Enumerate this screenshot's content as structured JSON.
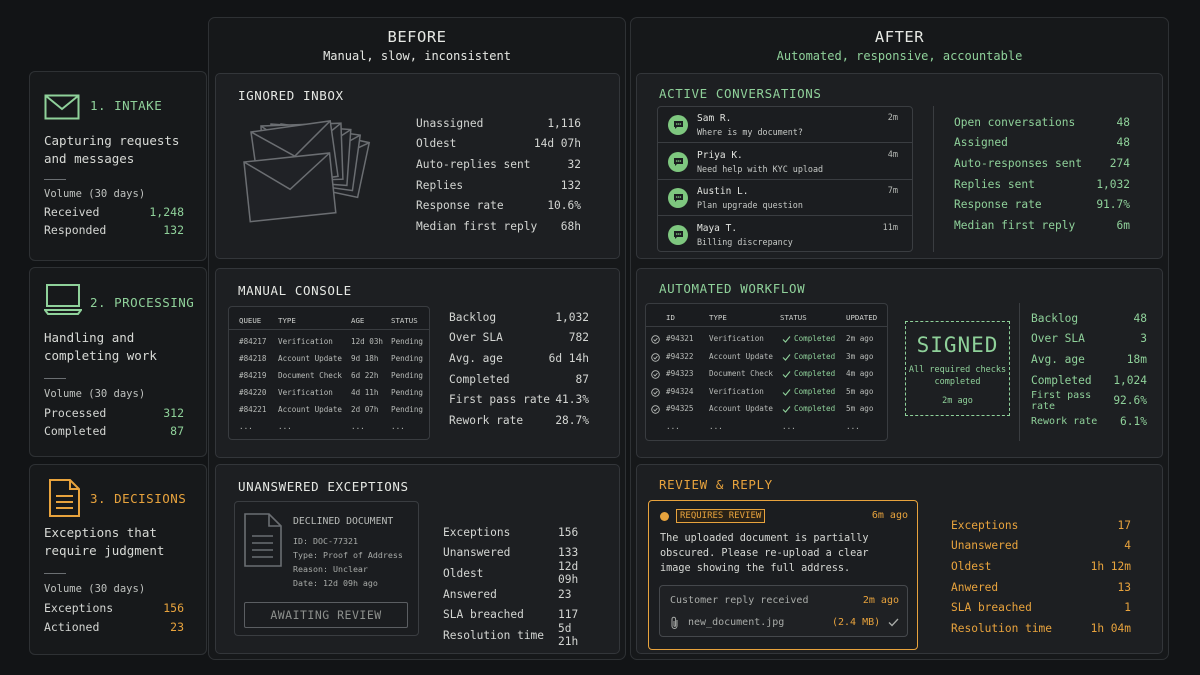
{
  "stages": [
    {
      "title": "1. INTAKE",
      "icon": "envelope-icon",
      "desc": "Capturing requests and messages",
      "volume_label": "Volume (30 days)",
      "rows": [
        {
          "label": "Received",
          "value": "1,248"
        },
        {
          "label": "Responded",
          "value": "132"
        }
      ]
    },
    {
      "title": "2. PROCESSING",
      "icon": "laptop-icon",
      "desc": "Handling and completing work",
      "volume_label": "Volume (30 days)",
      "rows": [
        {
          "label": "Processed",
          "value": "312"
        },
        {
          "label": "Completed",
          "value": "87"
        }
      ]
    },
    {
      "title": "3. DECISIONS",
      "icon": "document-icon",
      "desc": "Exceptions that require judgment",
      "volume_label": "Volume (30 days)",
      "rows": [
        {
          "label": "Exceptions",
          "value": "156"
        },
        {
          "label": "Actioned",
          "value": "23"
        }
      ]
    }
  ],
  "before": {
    "title": "BEFORE",
    "subtitle": "Manual, slow, inconsistent",
    "inbox": {
      "title": "IGNORED INBOX",
      "stats": [
        {
          "label": "Unassigned",
          "value": "1,116"
        },
        {
          "label": "Oldest",
          "value": "14d 07h"
        },
        {
          "label": "Auto-replies sent",
          "value": "32"
        },
        {
          "label": "Replies",
          "value": "132"
        },
        {
          "label": "Response rate",
          "value": "10.6%"
        },
        {
          "label": "Median first reply",
          "value": "68h"
        }
      ]
    },
    "console": {
      "title": "MANUAL CONSOLE",
      "headers": [
        "QUEUE",
        "TYPE",
        "AGE",
        "STATUS"
      ],
      "rows": [
        [
          "#84217",
          "Verification",
          "12d 03h",
          "Pending"
        ],
        [
          "#84218",
          "Account Update",
          "9d 18h",
          "Pending"
        ],
        [
          "#84219",
          "Document Check",
          "6d 22h",
          "Pending"
        ],
        [
          "#84220",
          "Verification",
          "4d 11h",
          "Pending"
        ],
        [
          "#84221",
          "Account Update",
          "2d 07h",
          "Pending"
        ],
        [
          "...",
          "...",
          "...",
          "..."
        ]
      ],
      "stats": [
        {
          "label": "Backlog",
          "value": "1,032"
        },
        {
          "label": "Over SLA",
          "value": "782"
        },
        {
          "label": "Avg. age",
          "value": "6d 14h"
        },
        {
          "label": "Completed",
          "value": "87"
        },
        {
          "label": "First pass rate",
          "value": "41.3%"
        },
        {
          "label": "Rework rate",
          "value": "28.7%"
        }
      ]
    },
    "exceptions": {
      "title": "UNANSWERED EXCEPTIONS",
      "card": {
        "heading": "DECLINED DOCUMENT",
        "lines": [
          "ID: DOC-77321",
          "Type: Proof of Address",
          "Reason: Unclear",
          "Date: 12d 09h ago"
        ],
        "button": "AWAITING REVIEW"
      },
      "stats": [
        {
          "label": "Exceptions",
          "value": "156"
        },
        {
          "label": "Unanswered",
          "value": "133"
        },
        {
          "label": "Oldest",
          "value": "12d 09h"
        },
        {
          "label": "Answered",
          "value": "23"
        },
        {
          "label": "SLA breached",
          "value": "117"
        },
        {
          "label": "Resolution time",
          "value": "5d 21h"
        }
      ]
    }
  },
  "after": {
    "title": "AFTER",
    "subtitle": "Automated, responsive, accountable",
    "conversations": {
      "title": "ACTIVE CONVERSATIONS",
      "items": [
        {
          "name": "Sam R.",
          "msg": "Where is my document?",
          "time": "2m"
        },
        {
          "name": "Priya K.",
          "msg": "Need help with KYC upload",
          "time": "4m"
        },
        {
          "name": "Austin L.",
          "msg": "Plan upgrade question",
          "time": "7m"
        },
        {
          "name": "Maya T.",
          "msg": "Billing discrepancy",
          "time": "11m"
        }
      ],
      "stats": [
        {
          "label": "Open conversations",
          "value": "48"
        },
        {
          "label": "Assigned",
          "value": "48"
        },
        {
          "label": "Auto-responses sent",
          "value": "274"
        },
        {
          "label": "Replies sent",
          "value": "1,032"
        },
        {
          "label": "Response rate",
          "value": "91.7%"
        },
        {
          "label": "Median first reply",
          "value": "6m"
        }
      ]
    },
    "workflow": {
      "title": "AUTOMATED WORKFLOW",
      "headers": [
        "ID",
        "TYPE",
        "STATUS",
        "UPDATED"
      ],
      "rows": [
        [
          "#94321",
          "Verification",
          "Completed",
          "2m ago"
        ],
        [
          "#94322",
          "Account Update",
          "Completed",
          "3m ago"
        ],
        [
          "#94323",
          "Document Check",
          "Completed",
          "4m ago"
        ],
        [
          "#94324",
          "Verification",
          "Completed",
          "5m ago"
        ],
        [
          "#94325",
          "Account Update",
          "Completed",
          "5m ago"
        ],
        [
          "...",
          "...",
          "...",
          "..."
        ]
      ],
      "stamp": {
        "big": "SIGNED",
        "line1": "All required checks",
        "line2": "completed",
        "time": "2m ago"
      },
      "stats": [
        {
          "label": "Backlog",
          "value": "48"
        },
        {
          "label": "Over SLA",
          "value": "3"
        },
        {
          "label": "Avg. age",
          "value": "18m"
        },
        {
          "label": "Completed",
          "value": "1,024"
        },
        {
          "label": "First pass rate",
          "value": "92.6%"
        },
        {
          "label": "Rework rate",
          "value": "6.1%"
        }
      ]
    },
    "review": {
      "title": "REVIEW & REPLY",
      "badge": "REQUIRES REVIEW",
      "badge_time": "6m ago",
      "message": "The uploaded document is partially obscured. Please re-upload a clear image showing the full address.",
      "reply_label": "Customer reply received",
      "reply_time": "2m ago",
      "file_name": "new_document.jpg",
      "file_size": "(2.4 MB)",
      "stats": [
        {
          "label": "Exceptions",
          "value": "17"
        },
        {
          "label": "Unanswered",
          "value": "4"
        },
        {
          "label": "Oldest",
          "value": "1h 12m"
        },
        {
          "label": "Anwered",
          "value": "13"
        },
        {
          "label": "SLA breached",
          "value": "1"
        },
        {
          "label": "Resolution time",
          "value": "1h 04m"
        }
      ]
    }
  },
  "colors": {
    "green": "#8fd19a",
    "orange": "#e8a33d",
    "background": "#121416"
  }
}
